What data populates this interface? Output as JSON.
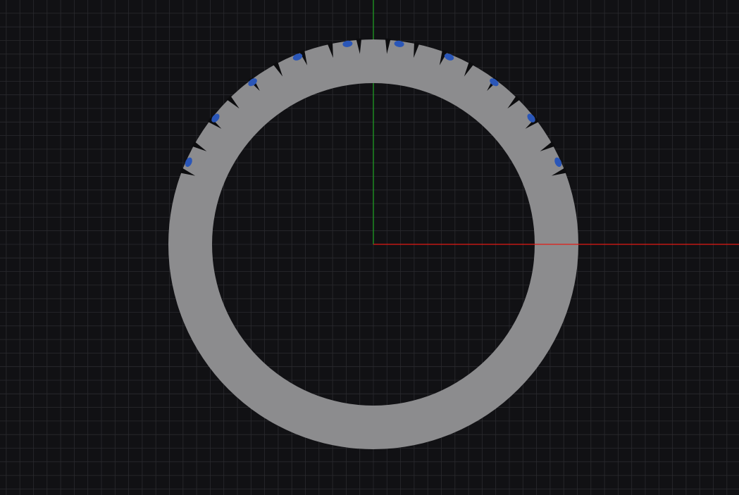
{
  "viewport": {
    "background_color": "#111114",
    "grid_color": "#2a2a2e",
    "x_axis_color": "#e11b14",
    "y_axis_color": "#1f9e24"
  },
  "model": {
    "ring_color": "#8c8c8e",
    "notch_color": "#0c0c0e",
    "highlight_color": "#2a56b8",
    "notch_count": 18,
    "highlight_count": 10
  }
}
